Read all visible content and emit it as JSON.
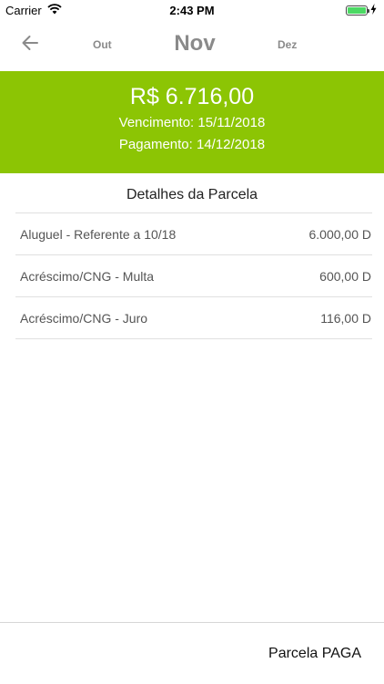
{
  "status_bar": {
    "carrier": "Carrier",
    "time": "2:43 PM",
    "battery_color": "#4cd964"
  },
  "month_nav": {
    "back_icon": "arrow-left-icon",
    "previous": "Out",
    "current": "Nov",
    "next": "Dez"
  },
  "summary": {
    "background": "#8cc504",
    "amount": "R$ 6.716,00",
    "due_date": "Vencimento: 15/11/2018",
    "payment_date": "Pagamento: 14/12/2018"
  },
  "details": {
    "title": "Detalhes da Parcela",
    "items": [
      {
        "label": "Aluguel - Referente a 10/18",
        "value": "6.000,00 D"
      },
      {
        "label": "Acréscimo/CNG - Multa",
        "value": "600,00 D"
      },
      {
        "label": "Acréscimo/CNG - Juro",
        "value": "116,00 D"
      }
    ]
  },
  "footer": {
    "status": "Parcela PAGA"
  }
}
